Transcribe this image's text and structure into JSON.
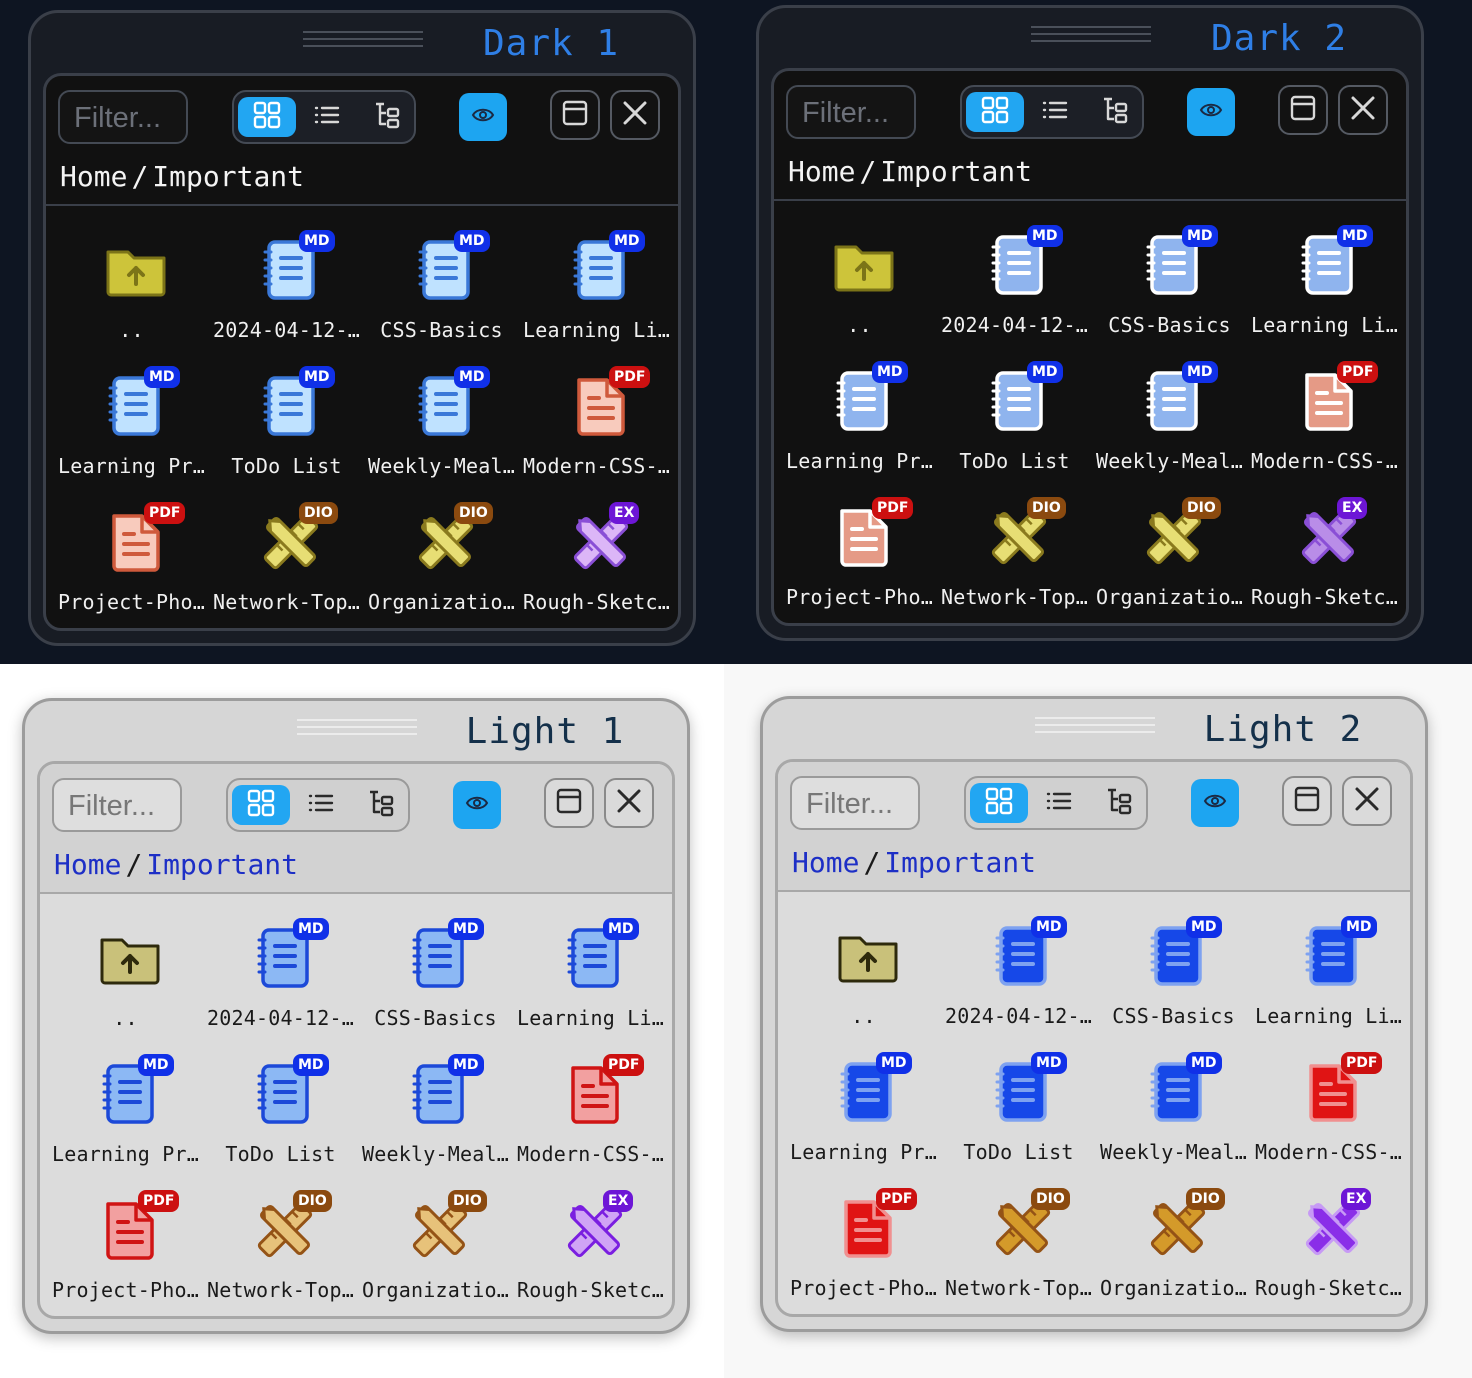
{
  "windows": [
    {
      "title": "Dark 1"
    },
    {
      "title": "Dark 2"
    },
    {
      "title": "Light 1"
    },
    {
      "title": "Light 2"
    }
  ],
  "toolbar": {
    "filter_placeholder": "Filter...",
    "view_modes": [
      "grid-view-icon",
      "list-view-icon",
      "tree-view-icon"
    ],
    "active_view": "grid-view-icon",
    "preview_icon": "eye-icon",
    "layout_icon": "window-layout-icon",
    "close_icon": "close-icon"
  },
  "breadcrumb": [
    "Home",
    "/",
    "Important"
  ],
  "files": [
    {
      "label": "..",
      "icon": "parent-folder-icon",
      "badge": ""
    },
    {
      "label": "2024-04-12-…",
      "icon": "markdown-file-icon",
      "badge": "MD"
    },
    {
      "label": "CSS-Basics",
      "icon": "markdown-file-icon",
      "badge": "MD"
    },
    {
      "label": "Learning Li…",
      "icon": "markdown-file-icon",
      "badge": "MD"
    },
    {
      "label": "Learning Pr…",
      "icon": "markdown-file-icon",
      "badge": "MD"
    },
    {
      "label": "ToDo List",
      "icon": "markdown-file-icon",
      "badge": "MD"
    },
    {
      "label": "Weekly-Meal…",
      "icon": "markdown-file-icon",
      "badge": "MD"
    },
    {
      "label": "Modern-CSS-…",
      "icon": "pdf-file-icon",
      "badge": "PDF"
    },
    {
      "label": "Project-Pho…",
      "icon": "pdf-file-icon",
      "badge": "PDF"
    },
    {
      "label": "Network-Top…",
      "icon": "diagram-file-icon",
      "badge": "DIO"
    },
    {
      "label": "Organizatio…",
      "icon": "diagram-file-icon",
      "badge": "DIO"
    },
    {
      "label": "Rough-Sketc…",
      "icon": "excalidraw-file-icon",
      "badge": "EX"
    }
  ],
  "themes": {
    "dark1": {
      "md_fill": "#bfe2ff",
      "md_stroke": "#3a78d8",
      "pdf_fill": "#f8cbbd",
      "pdf_stroke": "#cf5a3c",
      "dio_fill": "#e7de74",
      "dio_stroke": "#8a7a1e",
      "ex_fill": "#dcb6f7",
      "ex_stroke": "#8a4fd6",
      "folder_fill": "#cdc43a",
      "folder_stroke": "#7c7418"
    },
    "dark2": {
      "md_fill": "#8fb4ee",
      "md_stroke": "#ffffff",
      "pdf_fill": "#e59a86",
      "pdf_stroke": "#ffffff",
      "dio_fill": "#e7de74",
      "dio_stroke": "#8a7a1e",
      "ex_fill": "#b98de8",
      "ex_stroke": "#8a4fd6",
      "folder_fill": "#cdc43a",
      "folder_stroke": "#7c7418"
    },
    "light1": {
      "md_fill": "#8cb8f4",
      "md_stroke": "#1c49d8",
      "pdf_fill": "#f2a0a0",
      "pdf_stroke": "#d01414",
      "dio_fill": "#e7c27a",
      "dio_stroke": "#945316",
      "ex_fill": "#d0a4f5",
      "ex_stroke": "#7a1ee0",
      "folder_fill": "#c9c17a",
      "folder_stroke": "#2e2a0c"
    },
    "light2": {
      "md_fill": "#1648e8",
      "md_stroke": "#7ea2f0",
      "pdf_fill": "#e01414",
      "pdf_stroke": "#f09090",
      "dio_fill": "#d49a2a",
      "dio_stroke": "#945316",
      "ex_fill": "#8a2ee8",
      "ex_stroke": "#c79af5",
      "folder_fill": "#c9c17a",
      "folder_stroke": "#2e2a0c"
    }
  }
}
